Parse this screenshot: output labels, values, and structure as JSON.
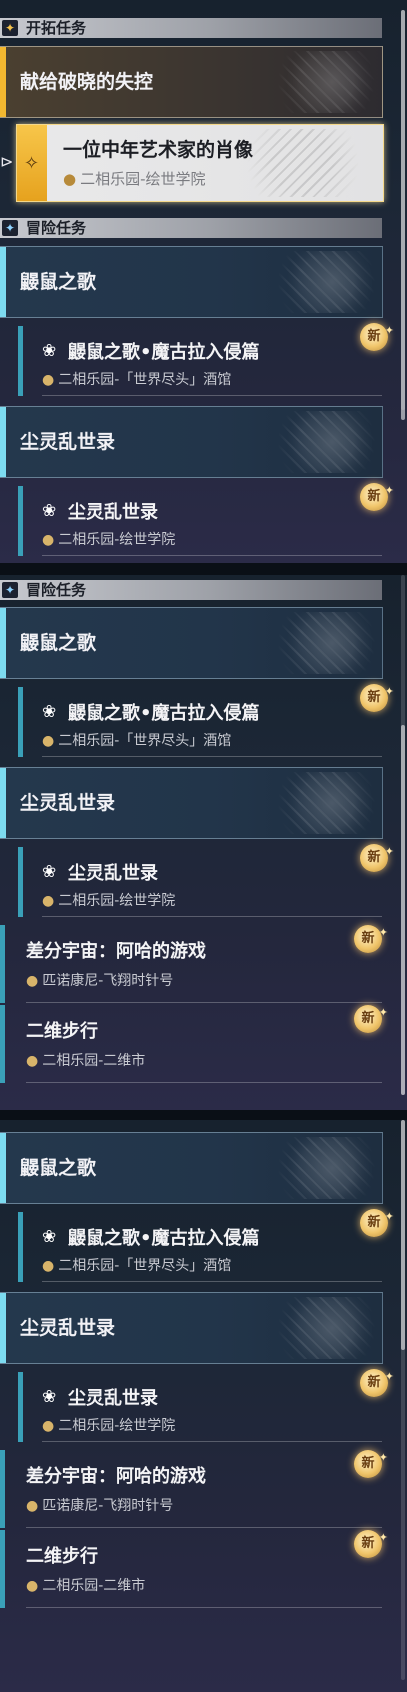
{
  "panel1": {
    "section_trailblaze": "开拓任务",
    "section_adventure": "冒险任务",
    "quest_main": "献给破晓的失控",
    "quest_selected": {
      "title": "一位中年艺术家的肖像",
      "location": "二相乐园-绘世学院"
    },
    "group1": "鼹鼠之歌",
    "sub1": {
      "title": "鼹鼠之歌•魔古拉入侵篇",
      "location": "二相乐园-「世界尽头」酒馆"
    },
    "group2": "尘灵乱世录",
    "sub2": {
      "title": "尘灵乱世录",
      "location": "二相乐园-绘世学院"
    }
  },
  "panel2": {
    "section_adventure": "冒险任务",
    "group1": "鼹鼠之歌",
    "sub1": {
      "title": "鼹鼠之歌•魔古拉入侵篇",
      "location": "二相乐园-「世界尽头」酒馆"
    },
    "group2": "尘灵乱世录",
    "sub2": {
      "title": "尘灵乱世录",
      "location": "二相乐园-绘世学院"
    },
    "item3": {
      "title": "差分宇宙：阿哈的游戏",
      "location": "匹诺康尼-飞翔时针号"
    },
    "item4": {
      "title": "二维步行",
      "location": "二相乐园-二维市"
    }
  },
  "panel3": {
    "group1": "鼹鼠之歌",
    "sub1": {
      "title": "鼹鼠之歌•魔古拉入侵篇",
      "location": "二相乐园-「世界尽头」酒馆"
    },
    "group2": "尘灵乱世录",
    "sub2": {
      "title": "尘灵乱世录",
      "location": "二相乐园-绘世学院"
    },
    "item3": {
      "title": "差分宇宙：阿哈的游戏",
      "location": "匹诺康尼-飞翔时针号"
    },
    "item4": {
      "title": "二维步行",
      "location": "二相乐园-二维市"
    }
  },
  "badge_new": "新",
  "icons": {
    "trailblaze": "trailblaze-star-icon",
    "adventure": "adventure-star-icon",
    "pin": "location-pin-icon",
    "quest": "quest-mole-icon",
    "arrow": "selection-arrow-icon"
  },
  "colors": {
    "accent_cyan": "#7ddbf0",
    "accent_gold": "#f2b830",
    "badge_gold": "#f0c56a"
  }
}
